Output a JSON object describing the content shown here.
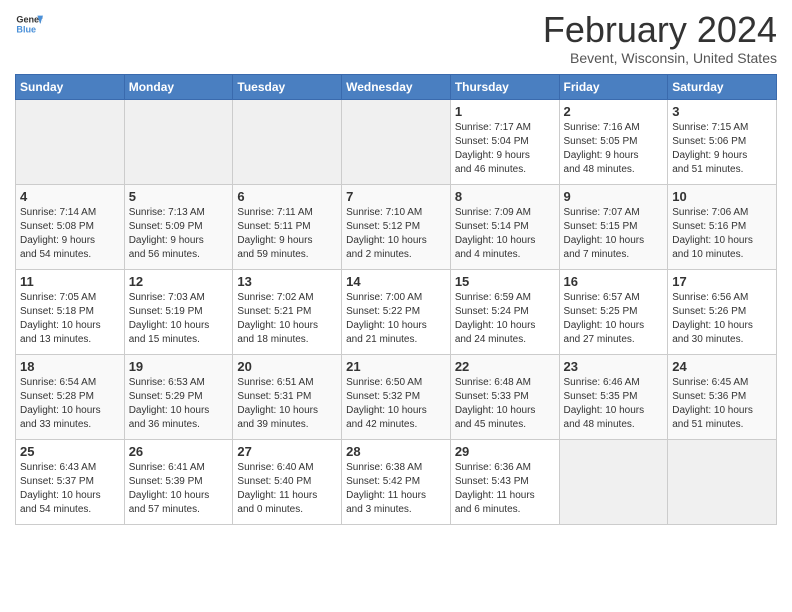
{
  "header": {
    "logo_line1": "General",
    "logo_line2": "Blue",
    "title": "February 2024",
    "subtitle": "Bevent, Wisconsin, United States"
  },
  "days_of_week": [
    "Sunday",
    "Monday",
    "Tuesday",
    "Wednesday",
    "Thursday",
    "Friday",
    "Saturday"
  ],
  "weeks": [
    [
      {
        "day": "",
        "info": ""
      },
      {
        "day": "",
        "info": ""
      },
      {
        "day": "",
        "info": ""
      },
      {
        "day": "",
        "info": ""
      },
      {
        "day": "1",
        "info": "Sunrise: 7:17 AM\nSunset: 5:04 PM\nDaylight: 9 hours\nand 46 minutes."
      },
      {
        "day": "2",
        "info": "Sunrise: 7:16 AM\nSunset: 5:05 PM\nDaylight: 9 hours\nand 48 minutes."
      },
      {
        "day": "3",
        "info": "Sunrise: 7:15 AM\nSunset: 5:06 PM\nDaylight: 9 hours\nand 51 minutes."
      }
    ],
    [
      {
        "day": "4",
        "info": "Sunrise: 7:14 AM\nSunset: 5:08 PM\nDaylight: 9 hours\nand 54 minutes."
      },
      {
        "day": "5",
        "info": "Sunrise: 7:13 AM\nSunset: 5:09 PM\nDaylight: 9 hours\nand 56 minutes."
      },
      {
        "day": "6",
        "info": "Sunrise: 7:11 AM\nSunset: 5:11 PM\nDaylight: 9 hours\nand 59 minutes."
      },
      {
        "day": "7",
        "info": "Sunrise: 7:10 AM\nSunset: 5:12 PM\nDaylight: 10 hours\nand 2 minutes."
      },
      {
        "day": "8",
        "info": "Sunrise: 7:09 AM\nSunset: 5:14 PM\nDaylight: 10 hours\nand 4 minutes."
      },
      {
        "day": "9",
        "info": "Sunrise: 7:07 AM\nSunset: 5:15 PM\nDaylight: 10 hours\nand 7 minutes."
      },
      {
        "day": "10",
        "info": "Sunrise: 7:06 AM\nSunset: 5:16 PM\nDaylight: 10 hours\nand 10 minutes."
      }
    ],
    [
      {
        "day": "11",
        "info": "Sunrise: 7:05 AM\nSunset: 5:18 PM\nDaylight: 10 hours\nand 13 minutes."
      },
      {
        "day": "12",
        "info": "Sunrise: 7:03 AM\nSunset: 5:19 PM\nDaylight: 10 hours\nand 15 minutes."
      },
      {
        "day": "13",
        "info": "Sunrise: 7:02 AM\nSunset: 5:21 PM\nDaylight: 10 hours\nand 18 minutes."
      },
      {
        "day": "14",
        "info": "Sunrise: 7:00 AM\nSunset: 5:22 PM\nDaylight: 10 hours\nand 21 minutes."
      },
      {
        "day": "15",
        "info": "Sunrise: 6:59 AM\nSunset: 5:24 PM\nDaylight: 10 hours\nand 24 minutes."
      },
      {
        "day": "16",
        "info": "Sunrise: 6:57 AM\nSunset: 5:25 PM\nDaylight: 10 hours\nand 27 minutes."
      },
      {
        "day": "17",
        "info": "Sunrise: 6:56 AM\nSunset: 5:26 PM\nDaylight: 10 hours\nand 30 minutes."
      }
    ],
    [
      {
        "day": "18",
        "info": "Sunrise: 6:54 AM\nSunset: 5:28 PM\nDaylight: 10 hours\nand 33 minutes."
      },
      {
        "day": "19",
        "info": "Sunrise: 6:53 AM\nSunset: 5:29 PM\nDaylight: 10 hours\nand 36 minutes."
      },
      {
        "day": "20",
        "info": "Sunrise: 6:51 AM\nSunset: 5:31 PM\nDaylight: 10 hours\nand 39 minutes."
      },
      {
        "day": "21",
        "info": "Sunrise: 6:50 AM\nSunset: 5:32 PM\nDaylight: 10 hours\nand 42 minutes."
      },
      {
        "day": "22",
        "info": "Sunrise: 6:48 AM\nSunset: 5:33 PM\nDaylight: 10 hours\nand 45 minutes."
      },
      {
        "day": "23",
        "info": "Sunrise: 6:46 AM\nSunset: 5:35 PM\nDaylight: 10 hours\nand 48 minutes."
      },
      {
        "day": "24",
        "info": "Sunrise: 6:45 AM\nSunset: 5:36 PM\nDaylight: 10 hours\nand 51 minutes."
      }
    ],
    [
      {
        "day": "25",
        "info": "Sunrise: 6:43 AM\nSunset: 5:37 PM\nDaylight: 10 hours\nand 54 minutes."
      },
      {
        "day": "26",
        "info": "Sunrise: 6:41 AM\nSunset: 5:39 PM\nDaylight: 10 hours\nand 57 minutes."
      },
      {
        "day": "27",
        "info": "Sunrise: 6:40 AM\nSunset: 5:40 PM\nDaylight: 11 hours\nand 0 minutes."
      },
      {
        "day": "28",
        "info": "Sunrise: 6:38 AM\nSunset: 5:42 PM\nDaylight: 11 hours\nand 3 minutes."
      },
      {
        "day": "29",
        "info": "Sunrise: 6:36 AM\nSunset: 5:43 PM\nDaylight: 11 hours\nand 6 minutes."
      },
      {
        "day": "",
        "info": ""
      },
      {
        "day": "",
        "info": ""
      }
    ]
  ]
}
